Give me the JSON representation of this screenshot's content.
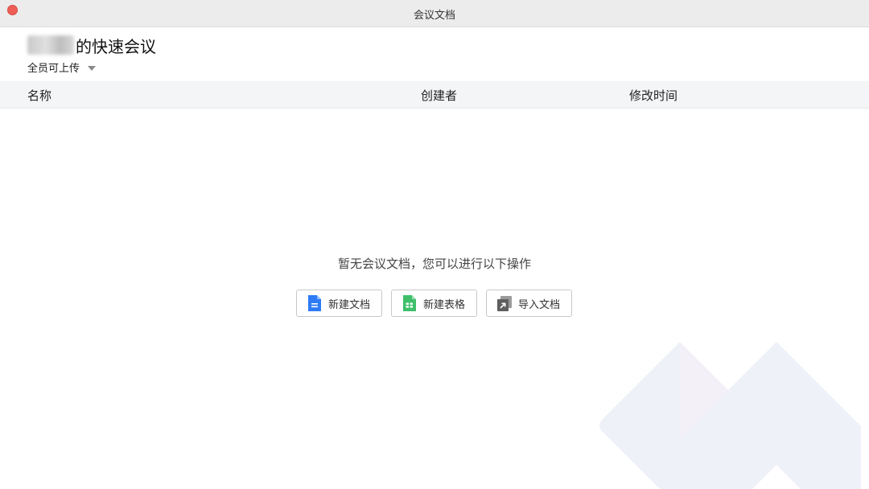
{
  "window": {
    "title": "会议文档"
  },
  "header": {
    "meeting_title_suffix": "的快速会议",
    "permission_label": "全员可上传"
  },
  "table": {
    "columns": [
      "名称",
      "创建者",
      "修改时间"
    ],
    "rows": []
  },
  "empty_state": {
    "message": "暂无会议文档，您可以进行以下操作"
  },
  "actions": [
    {
      "label": "新建文档",
      "icon": "doc-icon",
      "color": "#2f7bf5"
    },
    {
      "label": "新建表格",
      "icon": "sheet-icon",
      "color": "#3fbf6a"
    },
    {
      "label": "导入文档",
      "icon": "import-icon",
      "color": "#6b6b6b"
    }
  ],
  "colors": {
    "close_button": "#ee5e57",
    "titlebar": "#ececec",
    "table_header_bg": "#f4f5f7",
    "watermark": "#eef1f8"
  }
}
